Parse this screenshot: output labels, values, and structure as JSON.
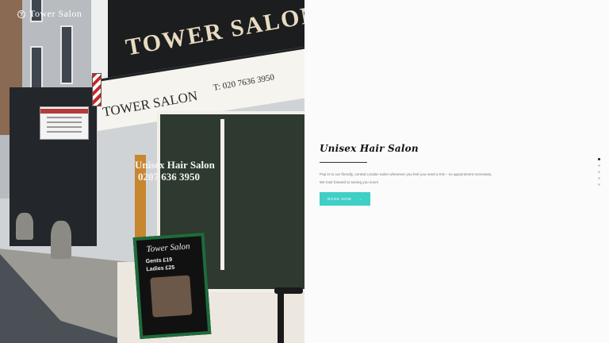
{
  "logo": {
    "text": "Tower Salon",
    "icon": "salon-emblem-icon"
  },
  "hero_photo": {
    "fascia_text": "TOWER SALON",
    "lower_sign_text": "TOWER SALON",
    "phone_sign": "T: 020 7636 3950",
    "window_text_line1": "Unisex Hair Salon",
    "window_text_line2": "0207 636 3950",
    "aboard_title": "Tower Salon",
    "aboard_gents": "Gents   £19",
    "aboard_ladies": "Ladies   £25"
  },
  "section": {
    "heading": "Unisex Hair Salon",
    "description_line1": "Pop in to our friendly, central London salon whenever you feel you need a trim - no appointment necessary.",
    "description_line2": "We look forward to seeing you soon!",
    "button_label": "BOOK NOW",
    "button_arrow": "→"
  },
  "slider": {
    "dot_count": 5,
    "active_index": 0
  },
  "colors": {
    "accent": "#3fcfc6",
    "heading": "#111111",
    "body_text": "#777777",
    "background": "#fbfbfb"
  }
}
